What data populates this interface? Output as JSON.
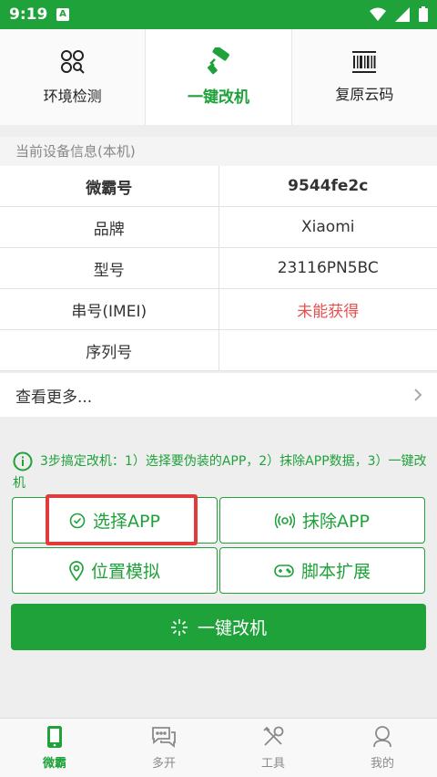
{
  "status": {
    "time": "9:19",
    "app_icon_letter": "A"
  },
  "top_tabs": [
    {
      "label": "环境检测",
      "icon": "circles-search-icon"
    },
    {
      "label": "一键改机",
      "icon": "paint-roller-icon",
      "active": true
    },
    {
      "label": "复原云码",
      "icon": "barcode-icon"
    }
  ],
  "device_section_title": "当前设备信息(本机)",
  "device_info": [
    {
      "key": "微霸号",
      "value": "9544fe2c"
    },
    {
      "key": "品牌",
      "value": "Xiaomi"
    },
    {
      "key": "型号",
      "value": "23116PN5BC"
    },
    {
      "key": "串号(IMEI)",
      "value": "未能获得"
    },
    {
      "key": "序列号",
      "value": ""
    }
  ],
  "more_label": "查看更多...",
  "tip_text": "3步搞定改机：1）选择要伪装的APP，2）抹除APP数据，3）一键改机",
  "actions": {
    "select_app": "选择APP",
    "erase_app": "抹除APP",
    "location": "位置模拟",
    "script": "脚本扩展"
  },
  "one_click_label": "一键改机",
  "bottom_nav": [
    {
      "label": "微霸",
      "icon": "phone-icon",
      "active": true
    },
    {
      "label": "多开",
      "icon": "chat-icon"
    },
    {
      "label": "工具",
      "icon": "tools-icon"
    },
    {
      "label": "我的",
      "icon": "user-icon"
    }
  ],
  "colors": {
    "brand": "#1fa23a",
    "warning": "#e84f4f",
    "highlight": "#e23b3b"
  }
}
